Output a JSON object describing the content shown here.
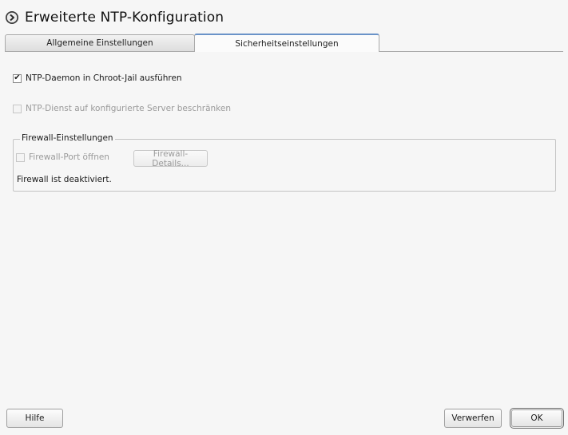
{
  "window": {
    "title": "Erweiterte NTP-Konfiguration",
    "icon": "yast-arrow-icon"
  },
  "tabs": [
    {
      "label": "Allgemeine Einstellungen",
      "active": false
    },
    {
      "label": "Sicherheitseinstellungen",
      "active": true
    }
  ],
  "security": {
    "chroot_checkbox": {
      "label": "NTP-Daemon in Chroot-Jail ausführen",
      "checked": true,
      "enabled": true,
      "check_glyph": "✔"
    },
    "restrict_checkbox": {
      "label": "NTP-Dienst auf konfigurierte Server beschränken",
      "checked": false,
      "enabled": false
    }
  },
  "firewall": {
    "group_title": "Firewall-Einstellungen",
    "open_port_checkbox": {
      "label": "Firewall-Port öffnen",
      "checked": false,
      "enabled": false
    },
    "details_button": {
      "label": "Firewall-Details...",
      "enabled": false
    },
    "status_text": "Firewall ist deaktiviert."
  },
  "buttons": {
    "help": "Hilfe",
    "discard": "Verwerfen",
    "ok": "OK"
  },
  "colors": {
    "background": "#f6f6f6",
    "tab_active_accent": "#6a93c8",
    "disabled_text": "#9a9a9a"
  }
}
